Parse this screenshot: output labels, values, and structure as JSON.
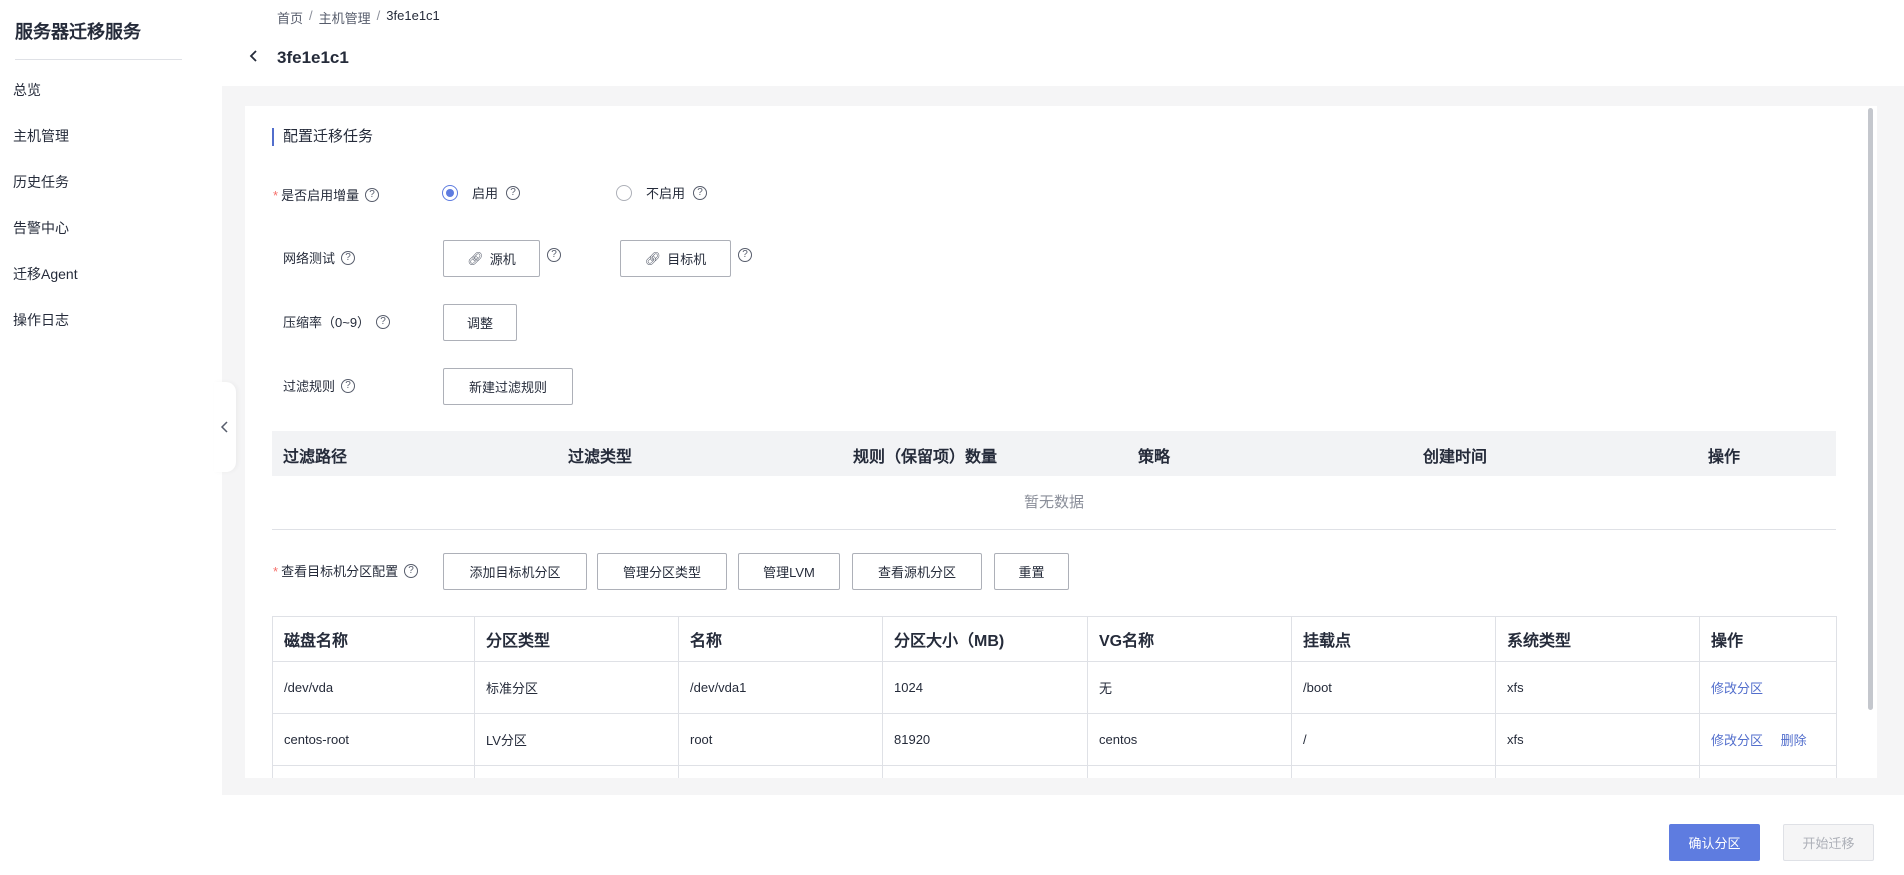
{
  "sidebar": {
    "title": "服务器迁移服务",
    "items": [
      {
        "label": "总览"
      },
      {
        "label": "主机管理"
      },
      {
        "label": "历史任务"
      },
      {
        "label": "告警中心"
      },
      {
        "label": "迁移Agent"
      },
      {
        "label": "操作日志"
      }
    ]
  },
  "breadcrumb": [
    "首页",
    "主机管理",
    "3fe1e1c1"
  ],
  "header": {
    "title": "3fe1e1c1"
  },
  "section": {
    "title": "配置迁移任务"
  },
  "incremental": {
    "label": "是否启用增量",
    "options": [
      {
        "label": "启用",
        "checked": true
      },
      {
        "label": "不启用",
        "checked": false
      }
    ]
  },
  "network_test": {
    "label": "网络测试",
    "source_button": "源机",
    "target_button": "目标机"
  },
  "compression": {
    "label": "压缩率（0~9）",
    "adjust_button": "调整"
  },
  "filter_rules": {
    "label": "过滤规则",
    "new_button": "新建过滤规则",
    "columns": [
      "过滤路径",
      "过滤类型",
      "规则（保留项）数量",
      "策略",
      "创建时间",
      "操作"
    ],
    "empty_text": "暂无数据"
  },
  "partition_config": {
    "label": "查看目标机分区配置",
    "buttons": [
      "添加目标机分区",
      "管理分区类型",
      "管理LVM",
      "查看源机分区",
      "重置"
    ],
    "columns": [
      "磁盘名称",
      "分区类型",
      "名称",
      "分区大小（MB)",
      "VG名称",
      "挂载点",
      "系统类型",
      "操作"
    ],
    "rows": [
      {
        "disk": "/dev/vda",
        "type": "标准分区",
        "name": "/dev/vda1",
        "size": "1024",
        "vg": "无",
        "mount": "/boot",
        "fs": "xfs",
        "actions": [
          "修改分区"
        ]
      },
      {
        "disk": "centos-root",
        "type": "LV分区",
        "name": "root",
        "size": "81920",
        "vg": "centos",
        "mount": "/",
        "fs": "xfs",
        "actions": [
          "修改分区",
          "删除"
        ]
      }
    ]
  },
  "footer": {
    "confirm_button": "确认分区",
    "start_button": "开始迁移"
  },
  "colors": {
    "accent": "#5e7ce0",
    "link": "#526ecc",
    "required": "#f66f6a"
  }
}
